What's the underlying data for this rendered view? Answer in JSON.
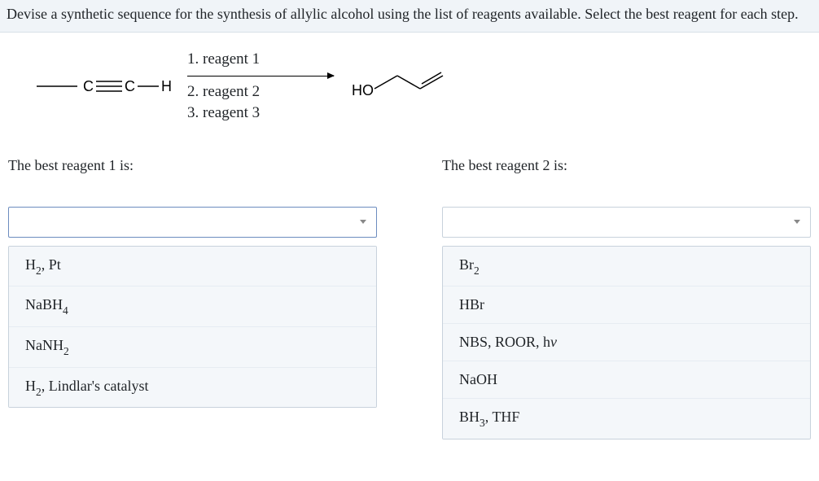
{
  "question": "Devise a synthetic sequence for the synthesis of allylic alcohol using the list of reagents available. Select the best reagent for each step.",
  "reaction": {
    "step1": "1. reagent 1",
    "step2": "2. reagent 2",
    "step3": "3. reagent 3",
    "starting_material": "propyne (CH3-C≡C-H)",
    "product": "allylic alcohol (HO-CH2-CH=CH2)"
  },
  "column1": {
    "prompt": "The best reagent 1 is:",
    "options": [
      {
        "html": "H<span class='sub'>2</span>, Pt"
      },
      {
        "html": "NaBH<span class='sub'>4</span>"
      },
      {
        "html": "NaNH<span class='sub'>2</span>"
      },
      {
        "html": "H<span class='sub'>2</span>, Lindlar's catalyst"
      }
    ]
  },
  "column2": {
    "prompt": "The best reagent 2 is:",
    "options": [
      {
        "html": "Br<span class='sub'>2</span>"
      },
      {
        "html": "HBr"
      },
      {
        "html": "NBS, ROOR, h<span class='ital'>v</span>"
      },
      {
        "html": "NaOH"
      },
      {
        "html": "BH<span class='sub'>3</span>, THF"
      }
    ]
  }
}
